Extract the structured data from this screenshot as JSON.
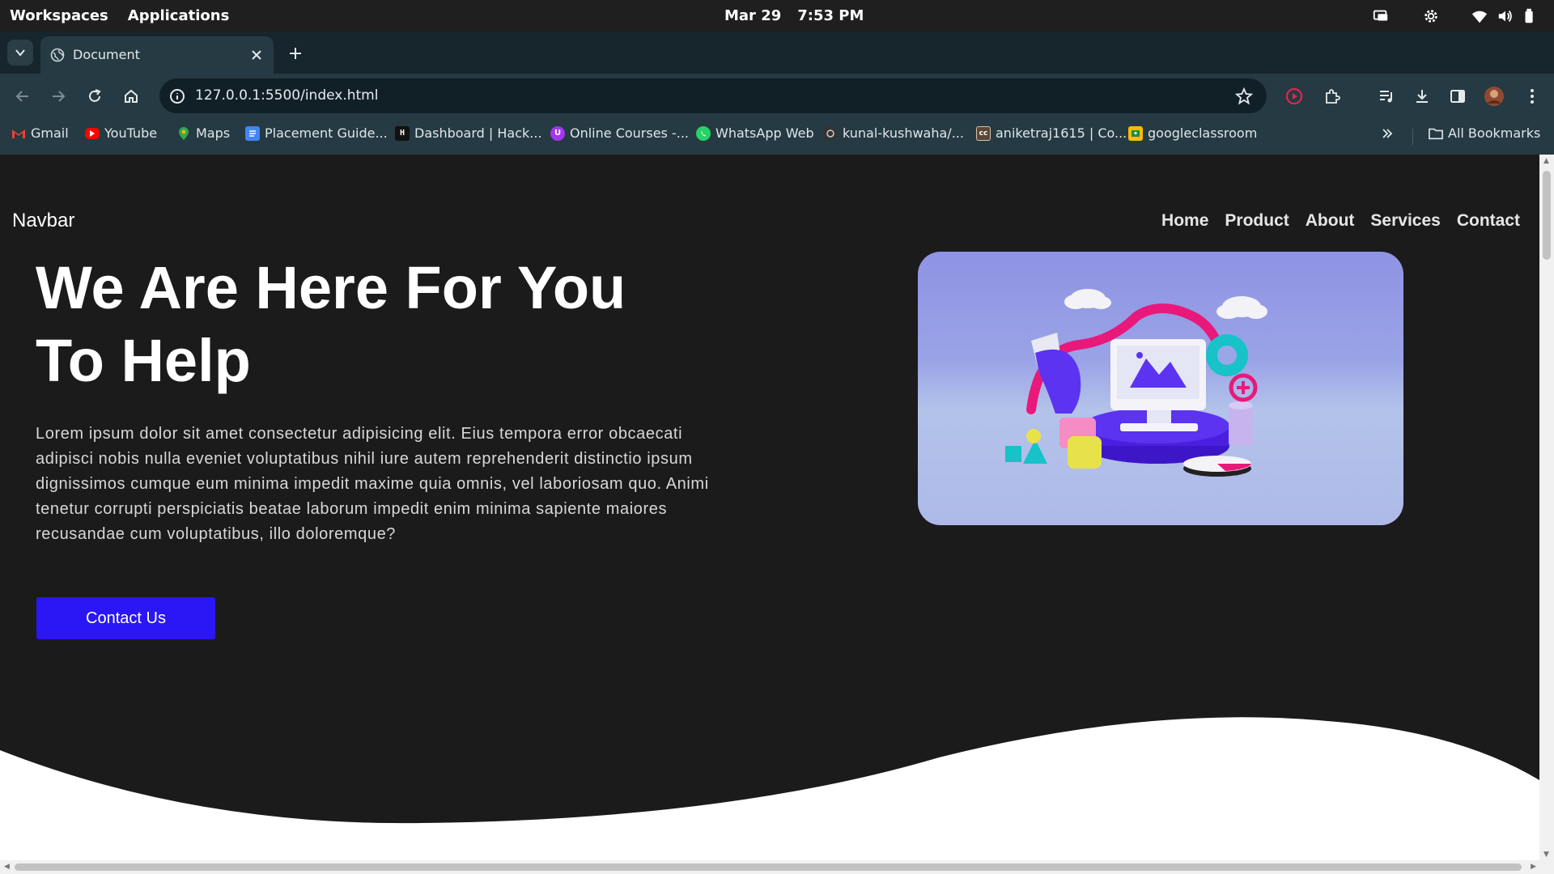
{
  "os_bar": {
    "workspaces": "Workspaces",
    "applications": "Applications",
    "date": "Mar 29",
    "time": "7:53 PM",
    "tray_icons": [
      "screen-icon",
      "settings-icon",
      "wifi-icon",
      "volume-icon",
      "battery-icon"
    ]
  },
  "browser": {
    "tab_title": "Document",
    "url": "127.0.0.1:5500/index.html",
    "bookmarks": [
      {
        "label": "Gmail",
        "icon": "gmail-icon",
        "color": "#ea4335"
      },
      {
        "label": "YouTube",
        "icon": "youtube-icon",
        "color": "#ff0000"
      },
      {
        "label": "Maps",
        "icon": "maps-icon",
        "color": "#34a853"
      },
      {
        "label": "Placement Guide...",
        "icon": "docs-icon",
        "color": "#4285f4"
      },
      {
        "label": "Dashboard | Hack...",
        "icon": "hackerrank-icon",
        "color": "#111111"
      },
      {
        "label": "Online Courses -...",
        "icon": "courses-icon",
        "color": "#a435f0"
      },
      {
        "label": "WhatsApp Web",
        "icon": "whatsapp-icon",
        "color": "#25d366"
      },
      {
        "label": "kunal-kushwaha/...",
        "icon": "github-icon",
        "color": "#333333"
      },
      {
        "label": "aniketraj1615 | Co...",
        "icon": "codechef-icon",
        "color": "#5b4638"
      },
      {
        "label": "googleclassroom",
        "icon": "classroom-icon",
        "color": "#fbbc04"
      }
    ],
    "all_bookmarks": "All Bookmarks"
  },
  "page": {
    "brand": "Navbar",
    "nav": [
      "Home",
      "Product",
      "About",
      "Services",
      "Contact"
    ],
    "hero_title": "We Are Here For You To Help",
    "hero_text": "Lorem ipsum dolor sit amet consectetur adipisicing elit. Eius tempora error obcaecati adipisci nobis nulla eveniet voluptatibus nihil iure autem reprehenderit distinctio ipsum dignissimos cumque eum minima impedit maxime quia omnis, vel laboriosam quo. Animi tenetur corrupti perspiciatis beatae laborum impedit enim minima sapiente maiores recusandae cum voluptatibus, illo doloremque?",
    "cta": "Contact Us",
    "accent_color": "#2b16f5",
    "background_color": "#1b1b1c"
  }
}
